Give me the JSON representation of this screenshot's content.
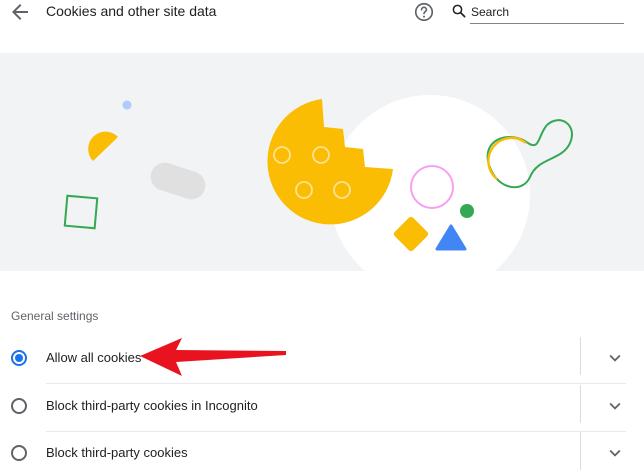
{
  "header": {
    "title": "Cookies and other site data",
    "back_icon": "arrow-back-icon",
    "help_icon": "help-icon",
    "search": {
      "placeholder": "Search",
      "icon": "search-icon"
    }
  },
  "illustration": {
    "name": "cookie-illustration"
  },
  "general_settings": {
    "title": "General settings",
    "options": [
      {
        "label": "Allow all cookies",
        "selected": true
      },
      {
        "label": "Block third-party cookies in Incognito",
        "selected": false
      },
      {
        "label": "Block third-party cookies",
        "selected": false
      }
    ]
  },
  "annotation": {
    "name": "red-arrow",
    "color": "#e8131f"
  },
  "colors": {
    "accent": "#1a73e8",
    "cookie": "#fbbc04",
    "hero_bg": "#f1f3f4"
  }
}
